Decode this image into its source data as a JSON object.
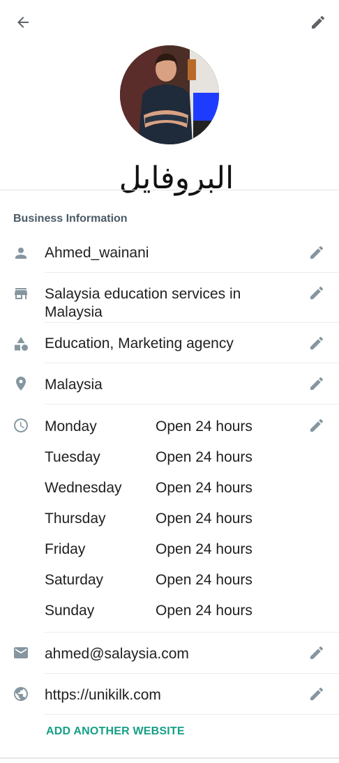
{
  "header": {
    "title": "البروفايل"
  },
  "section": {
    "title": "Business Information"
  },
  "rows": {
    "name": "Ahmed_wainani",
    "description": "Salaysia education services in Malaysia",
    "category": "Education, Marketing agency",
    "location": "Malaysia",
    "email": "ahmed@salaysia.com",
    "website": "https://unikilk.com"
  },
  "hours": [
    {
      "day": "Monday",
      "value": "Open 24 hours"
    },
    {
      "day": "Tuesday",
      "value": "Open 24 hours"
    },
    {
      "day": "Wednesday",
      "value": "Open 24 hours"
    },
    {
      "day": "Thursday",
      "value": "Open 24 hours"
    },
    {
      "day": "Friday",
      "value": "Open 24 hours"
    },
    {
      "day": "Saturday",
      "value": "Open 24 hours"
    },
    {
      "day": "Sunday",
      "value": "Open 24 hours"
    }
  ],
  "actions": {
    "add_website": "ADD ANOTHER WEBSITE"
  },
  "colors": {
    "icon": "#8696a0",
    "accent": "#14a085",
    "section_title": "#4a5a66"
  }
}
